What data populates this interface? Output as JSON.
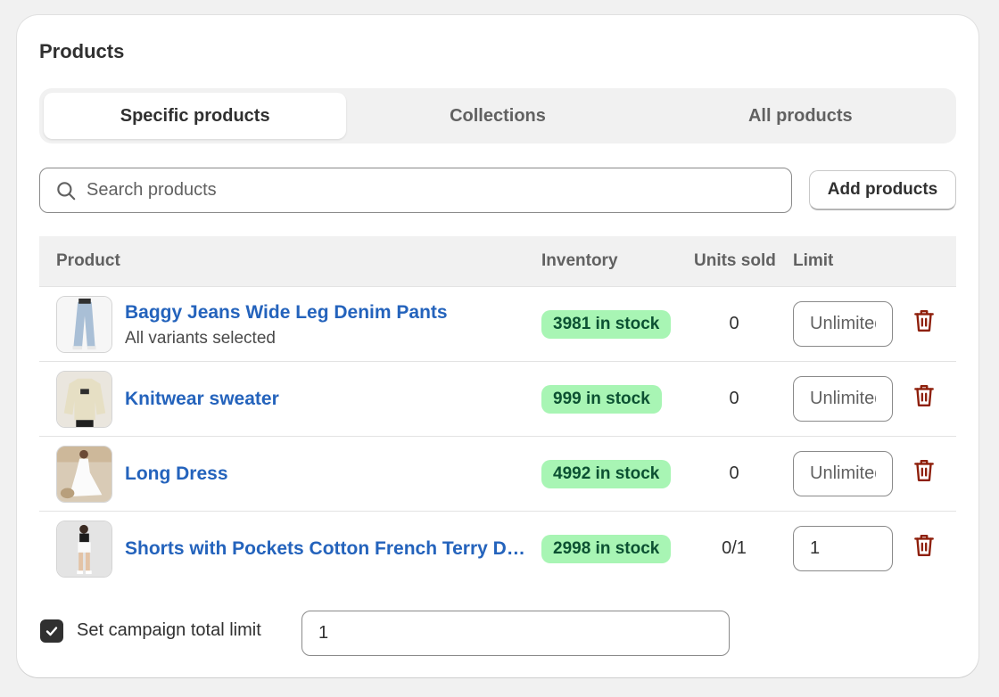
{
  "card": {
    "title": "Products"
  },
  "tabs": [
    {
      "label": "Specific products",
      "active": true
    },
    {
      "label": "Collections",
      "active": false
    },
    {
      "label": "All products",
      "active": false
    }
  ],
  "search": {
    "placeholder": "Search products",
    "value": "",
    "icon": "search-icon"
  },
  "add_button": {
    "label": "Add products"
  },
  "table": {
    "columns": {
      "product": "Product",
      "inventory": "Inventory",
      "units_sold": "Units sold",
      "limit": "Limit"
    },
    "rows": [
      {
        "name": "Baggy Jeans Wide Leg Denim Pants",
        "subtitle": "All variants selected",
        "inventory": "3981 in stock",
        "units_sold": "0",
        "limit_value": "",
        "limit_placeholder": "Unlimited"
      },
      {
        "name": "Knitwear sweater",
        "subtitle": "",
        "inventory": "999 in stock",
        "units_sold": "0",
        "limit_value": "",
        "limit_placeholder": "Unlimited"
      },
      {
        "name": "Long Dress",
        "subtitle": "",
        "inventory": "4992 in stock",
        "units_sold": "0",
        "limit_value": "",
        "limit_placeholder": "Unlimited"
      },
      {
        "name": "Shorts with Pockets Cotton French Terry Drawstring Shorts",
        "subtitle": "",
        "inventory": "2998 in stock",
        "units_sold": "0/1",
        "limit_value": "1",
        "limit_placeholder": "Unlimited"
      }
    ]
  },
  "campaign_limit": {
    "label": "Set campaign total limit",
    "checked": true,
    "value": "1"
  },
  "colors": {
    "link": "#2463bc",
    "badge_bg": "#a8f5b4",
    "badge_text": "#0c5132",
    "delete": "#8e1f0b"
  }
}
